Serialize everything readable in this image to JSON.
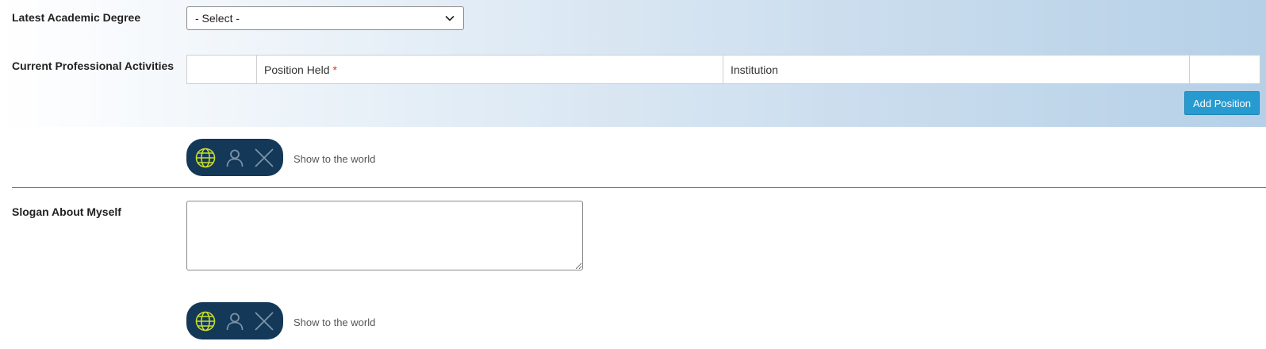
{
  "degree": {
    "label": "Latest Academic Degree",
    "selected": "- Select -"
  },
  "activities": {
    "label": "Current Professional Activities",
    "columns": [
      "",
      "Position Held",
      "Institution",
      ""
    ],
    "required_mark": "*",
    "add_button": "Add Position"
  },
  "privacy_1": {
    "text": "Show to the world"
  },
  "slogan": {
    "label": "Slogan About Myself",
    "value": ""
  },
  "privacy_2": {
    "text": "Show to the world"
  },
  "colors": {
    "accent": "#279ad0",
    "privacy_bg": "#133858",
    "active_icon": "#c8dc2a",
    "inactive_icon": "#7d93a8",
    "required": "#d9302b"
  },
  "icons": {
    "visibility_public": "globe-icon",
    "visibility_members": "person-icon",
    "visibility_private": "close-icon",
    "select_arrow": "chevron-down-icon"
  }
}
